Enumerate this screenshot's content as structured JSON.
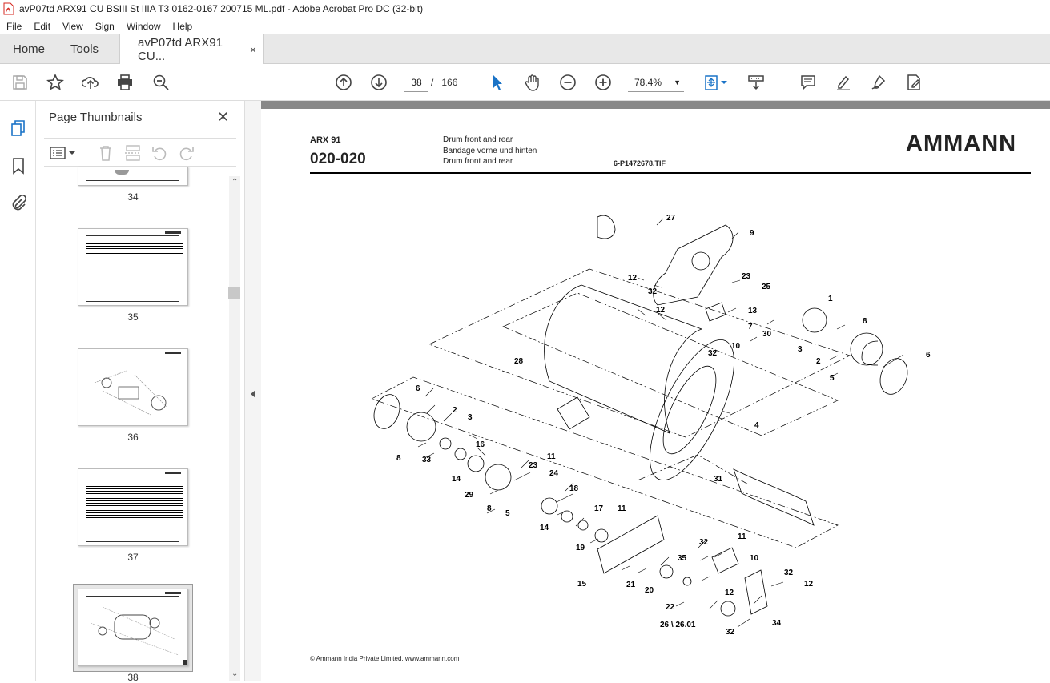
{
  "window": {
    "title": "avP07td ARX91 CU BSIII St IIIA T3 0162-0167 200715 ML.pdf - Adobe Acrobat Pro DC (32-bit)"
  },
  "menu": {
    "items": [
      "File",
      "Edit",
      "View",
      "Sign",
      "Window",
      "Help"
    ]
  },
  "tabs": {
    "home": "Home",
    "tools": "Tools",
    "doc": "avP07td ARX91 CU...",
    "close": "×"
  },
  "nav": {
    "current_page": "38",
    "page_sep": "/",
    "total_pages": "166",
    "zoom": "78.4%"
  },
  "thumbnails": {
    "title": "Page Thumbnails",
    "close": "✕",
    "pages": [
      "34",
      "35",
      "36",
      "37",
      "38"
    ],
    "selected": "38"
  },
  "document": {
    "model": "ARX 91",
    "code": "020-020",
    "desc_en": "Drum front and rear",
    "desc_de": "Bandage vorne und hinten",
    "desc_en2": "Drum front and rear",
    "file_ref": "6-P1472678.TIF",
    "brand": "AMMANN",
    "footer": "© Ammann India Private Limited, www.ammann.com",
    "callouts": [
      "27",
      "9",
      "12",
      "32",
      "23",
      "25",
      "12",
      "13",
      "7",
      "30",
      "1",
      "8",
      "3",
      "2",
      "5",
      "6",
      "10",
      "32",
      "28",
      "4",
      "6",
      "2",
      "3",
      "8",
      "33",
      "16",
      "14",
      "23",
      "24",
      "29",
      "8",
      "5",
      "18",
      "11",
      "14",
      "17",
      "19",
      "31",
      "11",
      "32",
      "11",
      "15",
      "21",
      "20",
      "35",
      "10",
      "12",
      "32",
      "12",
      "22",
      "26 \\ 26.01",
      "32",
      "34"
    ]
  },
  "colors": {
    "accent": "#1a73c7",
    "pdf_red": "#d5241c"
  }
}
